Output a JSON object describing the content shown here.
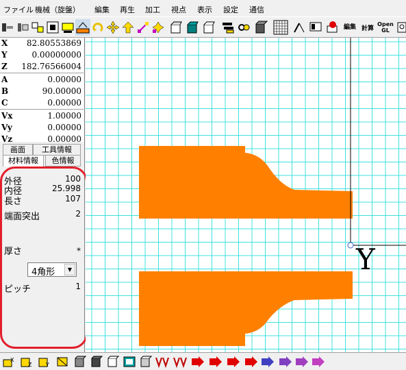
{
  "menu": [
    "ファイル",
    "機械（旋盤）",
    "編集",
    "再生",
    "加工",
    "視点",
    "表示",
    "設定",
    "通信"
  ],
  "toolbar": {
    "icons": [
      "lathe-icon",
      "chuck-icon",
      "tool-icon",
      "turret-icon",
      "holder-icon",
      "stock-icon",
      "rotate-icon",
      "move-icon",
      "up-arrow-icon",
      "scale-icon",
      "plus-icon",
      "box-open-icon",
      "box-teal-icon",
      "box-white-icon",
      "layers-icon",
      "coil-icon",
      "cube-icon",
      "grid-icon",
      "pen-icon",
      "display-icon",
      "record-icon",
      "edit-icon",
      "calc-icon",
      "open-gl-icon",
      "zoom-icon"
    ],
    "text_labels": {
      "edit": "編集",
      "calc": "計算",
      "open": "Open\nGL"
    }
  },
  "coords": [
    {
      "label": "X",
      "value": "82.80553869"
    },
    {
      "label": "Y",
      "value": "0.00000000"
    },
    {
      "label": "Z",
      "value": "182.76566004"
    },
    {
      "label": "A",
      "value": "0.00000"
    },
    {
      "label": "B",
      "value": "90.00000"
    },
    {
      "label": "C",
      "value": "0.00000"
    },
    {
      "label": "Vx",
      "value": "1.00000"
    },
    {
      "label": "Vy",
      "value": "0.00000"
    },
    {
      "label": "Vz",
      "value": "0.00000"
    }
  ],
  "tabs": {
    "screen": "画面",
    "tool_info": "工具情報",
    "material_info": "材料情報",
    "color_info": "色情報"
  },
  "material": {
    "outer_diameter_label": "外径",
    "outer_diameter": "100",
    "inner_diameter_label": "内径",
    "inner_diameter": "25.998",
    "length_label": "長さ",
    "length": "107",
    "end_protrusion_label": "端面突出",
    "end_protrusion": "2",
    "thickness_label": "厚さ",
    "thickness": "*",
    "shape_selected": "4角形",
    "pitch_label": "ピッチ",
    "pitch": "1"
  },
  "canvas": {
    "axis_label": "Y",
    "grid_color": "#40e0e0",
    "workpiece_color": "#ff8000"
  },
  "bottom_toolbar": {
    "icons": [
      "x-axis-icon",
      "z-axis-icon",
      "y-axis-icon",
      "cube-front-icon",
      "cube-side-icon",
      "screen-icon",
      "cube-wire-icon",
      "wave-icon",
      "wave2-icon",
      "arrow-red-icon",
      "arrow-red2-icon",
      "arrow-red3-icon",
      "arrow-red4-icon",
      "arrow-red5-icon",
      "block-icon",
      "skip-icon",
      "end-icon"
    ]
  }
}
